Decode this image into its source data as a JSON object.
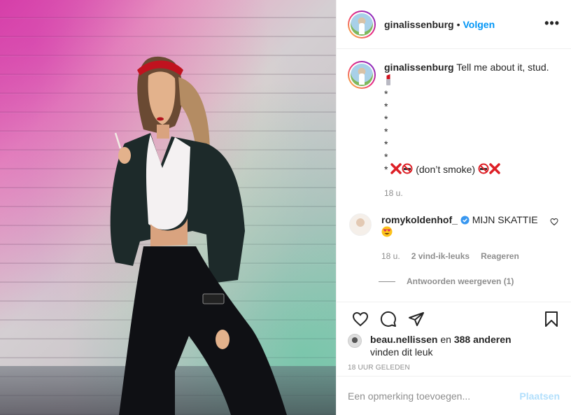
{
  "photo": {
    "alt_icon": "photo-woman-leather-jacket"
  },
  "header": {
    "username": "ginalissenburg",
    "separator": "•",
    "follow_label": "Volgen",
    "more_label": "•••"
  },
  "caption": {
    "username": "ginalissenburg",
    "text": "Tell me about it, stud.",
    "emoji_lipstick": "lipstick-icon",
    "stars": [
      "*",
      "*",
      "*",
      "*",
      "*",
      "*",
      "*"
    ],
    "last_line_text": "(don’t smoke)",
    "time": "18 u."
  },
  "comment": {
    "username": "romykoldenhof_",
    "verified": true,
    "text": "MIJN SKATTIE",
    "emoji": "heart-eyes-icon",
    "time": "18 u.",
    "likes": "2 vind-ik-leuks",
    "reply_label": "Reageren",
    "view_replies": "Antwoorden weergeven (1)"
  },
  "likes": {
    "user": "beau.nellissen",
    "connector": "en",
    "others": "388 anderen",
    "suffix": "vinden dit leuk"
  },
  "timestamp": "18 UUR GELEDEN",
  "add_comment": {
    "placeholder": "Een opmerking toevoegen...",
    "post_label": "Plaatsen"
  },
  "colors": {
    "accent": "#0095f6",
    "post_disabled": "#b2dffc",
    "muted": "#8e8e8e",
    "text": "#262626"
  }
}
